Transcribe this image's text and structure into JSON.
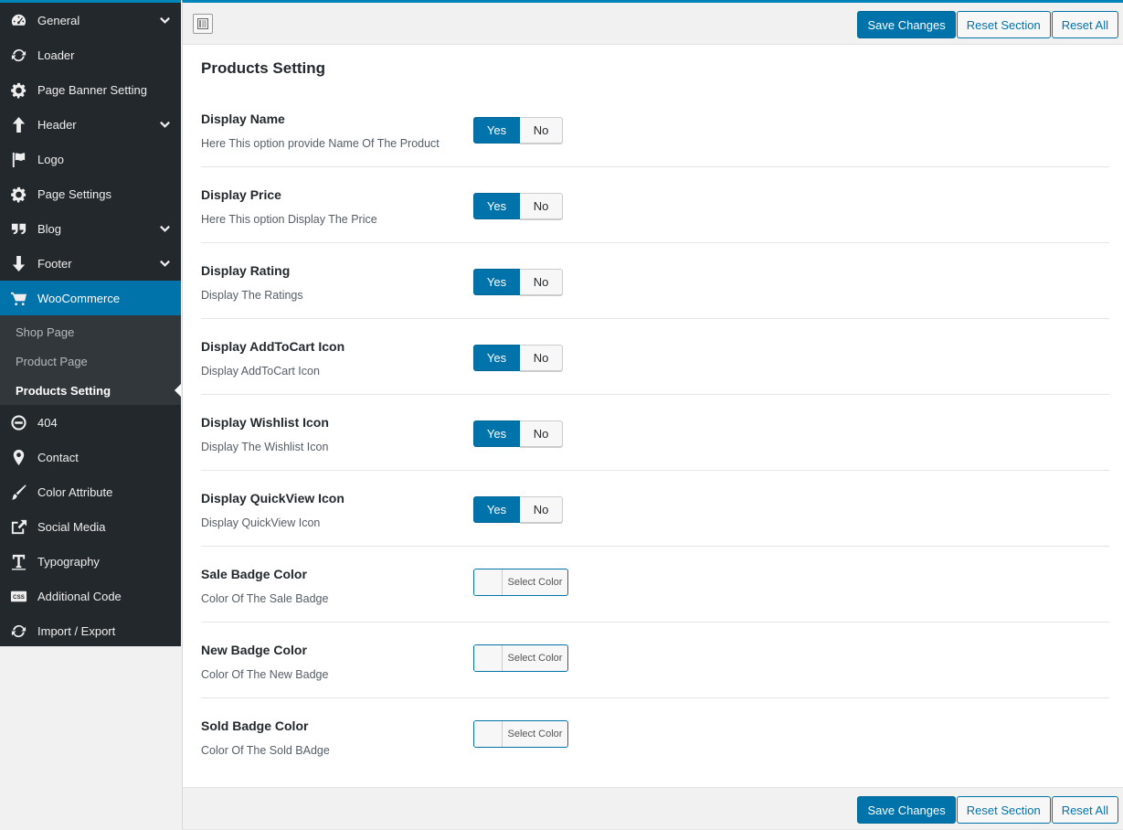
{
  "sidebar": {
    "items": [
      {
        "label": "General",
        "icon": "dashboard-gauge-icon",
        "chevron": true
      },
      {
        "label": "Loader",
        "icon": "refresh-icon",
        "chevron": false
      },
      {
        "label": "Page Banner Setting",
        "icon": "gear-icon",
        "chevron": false
      },
      {
        "label": "Header",
        "icon": "arrow-up-icon",
        "chevron": true
      },
      {
        "label": "Logo",
        "icon": "flag-icon",
        "chevron": false
      },
      {
        "label": "Page Settings",
        "icon": "gear-icon",
        "chevron": false
      },
      {
        "label": "Blog",
        "icon": "quote-icon",
        "chevron": true
      },
      {
        "label": "Footer",
        "icon": "arrow-down-icon",
        "chevron": true
      },
      {
        "label": "WooCommerce",
        "icon": "cart-icon",
        "chevron": false,
        "active": true
      }
    ],
    "subitems": [
      {
        "label": "Shop Page",
        "current": false
      },
      {
        "label": "Product Page",
        "current": false
      },
      {
        "label": "Products Setting",
        "current": true
      }
    ],
    "items_after": [
      {
        "label": "404",
        "icon": "no-entry-icon"
      },
      {
        "label": "Contact",
        "icon": "location-pin-icon"
      },
      {
        "label": "Color Attribute",
        "icon": "brush-icon"
      },
      {
        "label": "Social Media",
        "icon": "share-icon"
      },
      {
        "label": "Typography",
        "icon": "text-t-icon"
      },
      {
        "label": "Additional Code",
        "icon": "css-icon"
      },
      {
        "label": "Import / Export",
        "icon": "refresh-icon"
      }
    ]
  },
  "toolbar": {
    "save_label": "Save Changes",
    "reset_section_label": "Reset Section",
    "reset_all_label": "Reset All"
  },
  "section": {
    "title": "Products Setting"
  },
  "options": [
    {
      "type": "toggle",
      "label": "Display Name",
      "desc": "Here This option provide Name Of The Product",
      "yes": "Yes",
      "no": "No",
      "value": "Yes"
    },
    {
      "type": "toggle",
      "label": "Display Price",
      "desc": "Here This option Display The Price",
      "yes": "Yes",
      "no": "No",
      "value": "Yes"
    },
    {
      "type": "toggle",
      "label": "Display Rating",
      "desc": "Display The Ratings",
      "yes": "Yes",
      "no": "No",
      "value": "Yes"
    },
    {
      "type": "toggle",
      "label": "Display AddToCart Icon",
      "desc": "Display AddToCart Icon",
      "yes": "Yes",
      "no": "No",
      "value": "Yes"
    },
    {
      "type": "toggle",
      "label": "Display Wishlist Icon",
      "desc": "Display The Wishlist Icon",
      "yes": "Yes",
      "no": "No",
      "value": "Yes"
    },
    {
      "type": "toggle",
      "label": "Display QuickView Icon",
      "desc": "Display QuickView Icon",
      "yes": "Yes",
      "no": "No",
      "value": "Yes"
    },
    {
      "type": "color",
      "label": "Sale Badge Color",
      "desc": "Color Of The Sale Badge",
      "button": "Select Color"
    },
    {
      "type": "color",
      "label": "New Badge Color",
      "desc": "Color Of The New Badge",
      "button": "Select Color"
    },
    {
      "type": "color",
      "label": "Sold Badge Color",
      "desc": "Color Of The Sold BAdge",
      "button": "Select Color"
    }
  ],
  "colors": {
    "accent": "#0073aa",
    "sidebar_bg": "#23282d",
    "sub_bg": "#32373c"
  }
}
